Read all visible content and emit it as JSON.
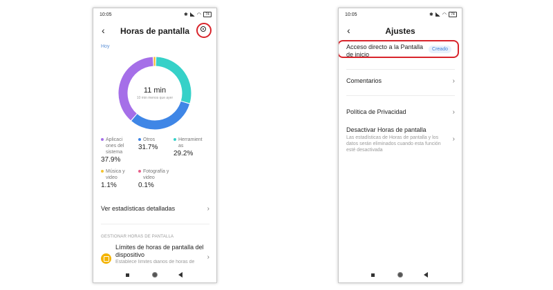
{
  "left": {
    "status": {
      "time": "10:05",
      "battery": "74"
    },
    "header": {
      "title": "Horas de pantalla"
    },
    "today_label": "Hoy",
    "center": {
      "value": "11 min",
      "sub": "10 min menos que ayer"
    },
    "colors": {
      "purple": "#a56fe8",
      "blue": "#3f86e6",
      "teal": "#36d1c8",
      "yellow": "#f4c430",
      "pink": "#e85f8a"
    },
    "chart_data": {
      "type": "pie",
      "categories": [
        "Aplicaciones del sistema",
        "Otros",
        "Herramientas",
        "Música y video",
        "Fotografía y video"
      ],
      "values": [
        37.9,
        31.7,
        29.2,
        1.1,
        0.1
      ]
    },
    "legend": [
      {
        "label": "Aplicaci\nones del\nsistema",
        "pct": "37.9%"
      },
      {
        "label": "Otros",
        "pct": "31.7%"
      },
      {
        "label": "Herramient\nas",
        "pct": "29.2%"
      },
      {
        "label": "Música y\nvideo",
        "pct": "1.1%"
      },
      {
        "label": "Fotografía y\nvideo",
        "pct": "0.1%"
      }
    ],
    "detail_link": "Ver estadísticas detalladas",
    "section_header": "GESTIONAR HORAS DE PANTALLA",
    "limits": {
      "title": "Límites de horas de pantalla del dispositivo",
      "desc": "Establece límites diarios de horas de"
    }
  },
  "right": {
    "status": {
      "time": "10:05",
      "battery": "74"
    },
    "header": {
      "title": "Ajustes"
    },
    "items": [
      {
        "title": "Acceso directo a la Pantalla de inicio",
        "badge": "Creado"
      },
      {
        "title": "Comentarios"
      },
      {
        "title": "Política de Privacidad"
      },
      {
        "title": "Desactivar Horas de pantalla",
        "desc": "Las estadísticas de Horas de pantalla y los datos serán eliminados cuando esta función esté desactivada"
      }
    ]
  }
}
